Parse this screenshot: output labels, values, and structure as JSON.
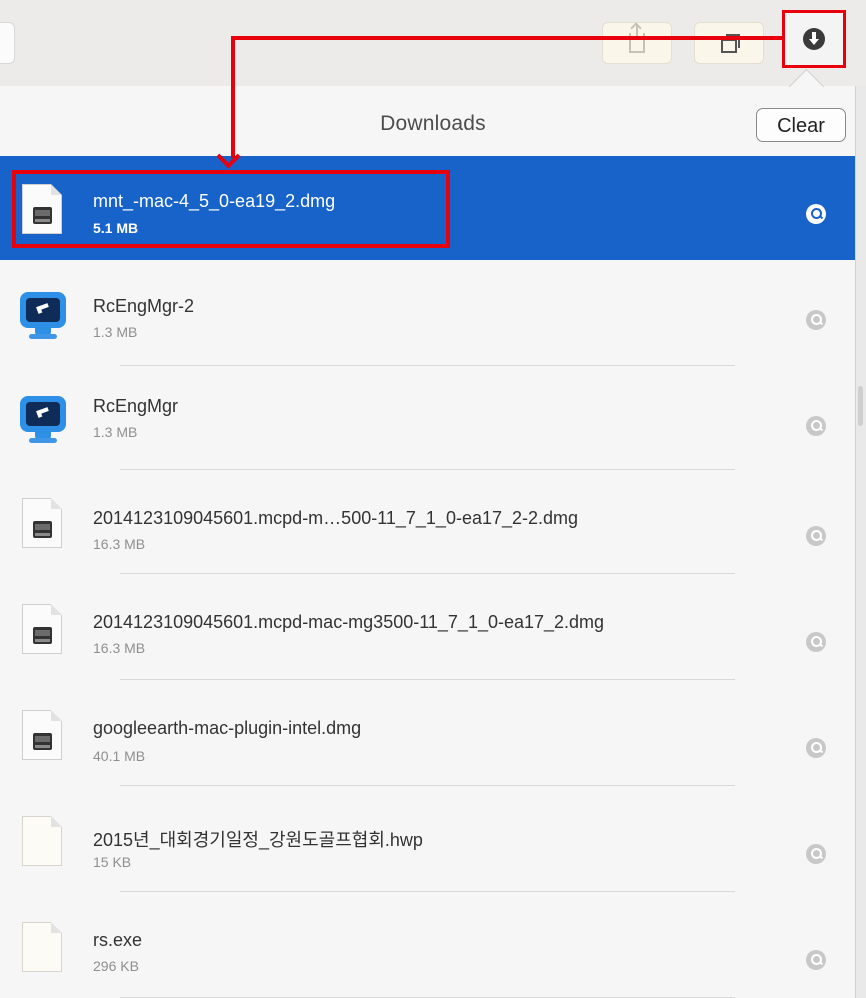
{
  "popover": {
    "title": "Downloads",
    "clear_label": "Clear"
  },
  "toolbar": {
    "buttons": [
      "share-icon",
      "tabs-icon",
      "downloads-icon"
    ]
  },
  "downloads": [
    {
      "name": "mnt_-mac-4_5_0-ea19_2.dmg",
      "size": "5.1 MB",
      "icon": "disk-image-icon",
      "selected": true
    },
    {
      "name": "RcEngMgr-2",
      "size": "1.3 MB",
      "icon": "app-icon",
      "selected": false
    },
    {
      "name": "RcEngMgr",
      "size": "1.3 MB",
      "icon": "app-icon",
      "selected": false
    },
    {
      "name": "2014123109045601.mcpd-m…500-11_7_1_0-ea17_2-2.dmg",
      "size": "16.3 MB",
      "icon": "disk-image-icon",
      "selected": false
    },
    {
      "name": "2014123109045601.mcpd-mac-mg3500-11_7_1_0-ea17_2.dmg",
      "size": "16.3 MB",
      "icon": "disk-image-icon",
      "selected": false
    },
    {
      "name": "googleearth-mac-plugin-intel.dmg",
      "size": "40.1 MB",
      "icon": "disk-image-icon",
      "selected": false
    },
    {
      "name": "2015년_대회경기일정_강원도골프협회.hwp",
      "size": "15 KB",
      "icon": "document-icon",
      "selected": false
    },
    {
      "name": "rs.exe",
      "size": "296 KB",
      "icon": "document-icon",
      "selected": false
    }
  ],
  "colors": {
    "selection": "#1763c9",
    "annotation": "#e8000c"
  }
}
